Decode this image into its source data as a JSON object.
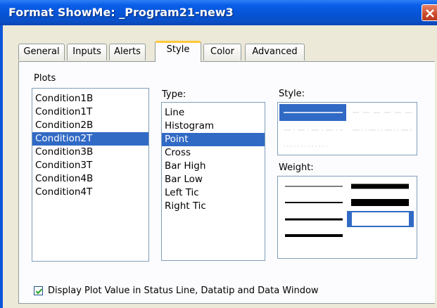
{
  "window": {
    "title": "Format ShowMe: _Program21-new3"
  },
  "tabs": [
    {
      "label": "General",
      "active": false
    },
    {
      "label": "Inputs",
      "active": false
    },
    {
      "label": "Alerts",
      "active": false
    },
    {
      "label": "Style",
      "active": true
    },
    {
      "label": "Color",
      "active": false
    },
    {
      "label": "Advanced",
      "active": false
    }
  ],
  "plots": {
    "label": "Plots",
    "items": [
      "Condition1B",
      "Condition1T",
      "Condition2B",
      "Condition2T",
      "Condition3B",
      "Condition3T",
      "Condition4B",
      "Condition4T"
    ],
    "selected": "Condition2T"
  },
  "type": {
    "label": "Type:",
    "items": [
      "Line",
      "Histogram",
      "Point",
      "Cross",
      "Bar High",
      "Bar Low",
      "Left Tic",
      "Right Tic"
    ],
    "selected": "Point"
  },
  "style": {
    "label": "Style:",
    "options": [
      "solid",
      "dashed",
      "dash-dot",
      "dash-dot-dot",
      "dotted"
    ],
    "selected": "solid"
  },
  "weight": {
    "label": "Weight:",
    "options": [
      "weight-1",
      "weight-2",
      "weight-3",
      "weight-4",
      "weight-5",
      "weight-6",
      "weight-7"
    ],
    "selected": "weight-7"
  },
  "display_option": {
    "label": "Display Plot Value in Status Line, Datatip and Data Window",
    "checked": true
  },
  "colors": {
    "titlebar": "#0654d6",
    "selection": "#316ac5",
    "tab_highlight": "#ffc83c"
  }
}
